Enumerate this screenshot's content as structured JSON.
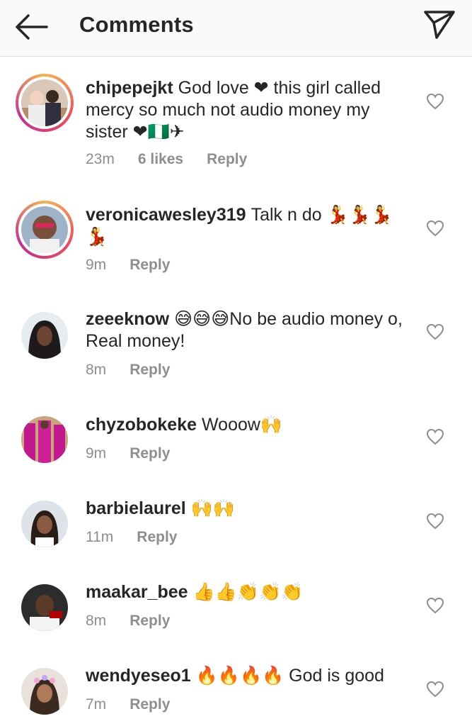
{
  "header": {
    "title": "Comments",
    "back_icon": "arrow-left-icon",
    "share_icon": "paper-plane-icon"
  },
  "comments": [
    {
      "username": "chipepejkt",
      "text": "God love ❤ this girl called mercy so much not audio money my sister ❤🇳🇬✈",
      "time": "23m",
      "likes": "6 likes",
      "reply": "Reply"
    },
    {
      "username": "veronicawesley319",
      "text": "Talk n do 💃💃💃 💃",
      "time": "9m",
      "reply": "Reply"
    },
    {
      "username": "zeeeknow",
      "text": "😅😅😅No be audio money o, Real money!",
      "time": "8m",
      "reply": "Reply"
    },
    {
      "username": "chyzobokeke",
      "text": "Wooow🙌",
      "time": "9m",
      "reply": "Reply"
    },
    {
      "username": "barbielaurel",
      "text": "🙌🙌",
      "time": "11m",
      "reply": "Reply"
    },
    {
      "username": "maakar_bee",
      "text": "👍👍👏👏👏",
      "time": "8m",
      "reply": "Reply"
    },
    {
      "username": "wendyeseo1",
      "text": "🔥🔥🔥🔥 God is good",
      "time": "7m",
      "reply": "Reply"
    }
  ],
  "colors": {
    "username": "#262626",
    "meta": "#8e8e8e",
    "heart_red": "#e0245e",
    "divider": "#dbdbdb"
  }
}
